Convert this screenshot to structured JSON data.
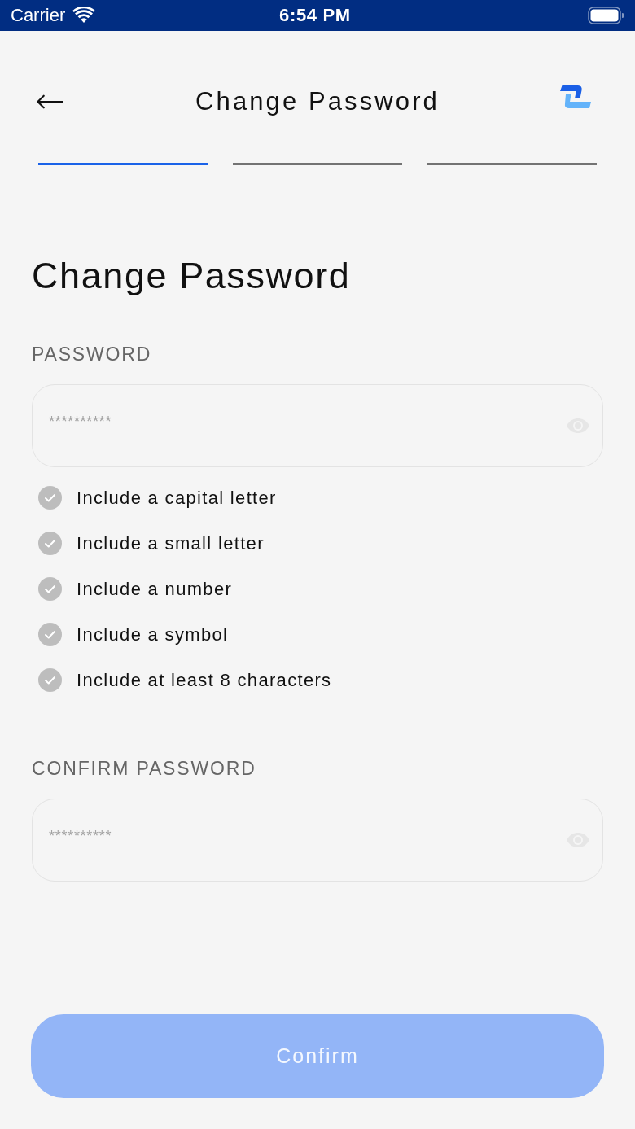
{
  "status_bar": {
    "carrier": "Carrier",
    "time": "6:54 PM"
  },
  "header": {
    "title": "Change Password"
  },
  "steps": [
    {
      "active": true
    },
    {
      "active": false
    },
    {
      "active": false
    }
  ],
  "heading": "Change Password",
  "fields": [
    {
      "label": "PASSWORD",
      "placeholder": "**********"
    },
    {
      "label": "CONFIRM PASSWORD",
      "placeholder": "**********"
    }
  ],
  "requirements": [
    {
      "text": "Include a capital letter",
      "met": false
    },
    {
      "text": "Include a small letter",
      "met": false
    },
    {
      "text": "Include a number",
      "met": false
    },
    {
      "text": "Include a symbol",
      "met": false
    },
    {
      "text": "Include at least 8 characters",
      "met": false
    }
  ],
  "button": {
    "label": "Confirm",
    "disabled": true
  }
}
